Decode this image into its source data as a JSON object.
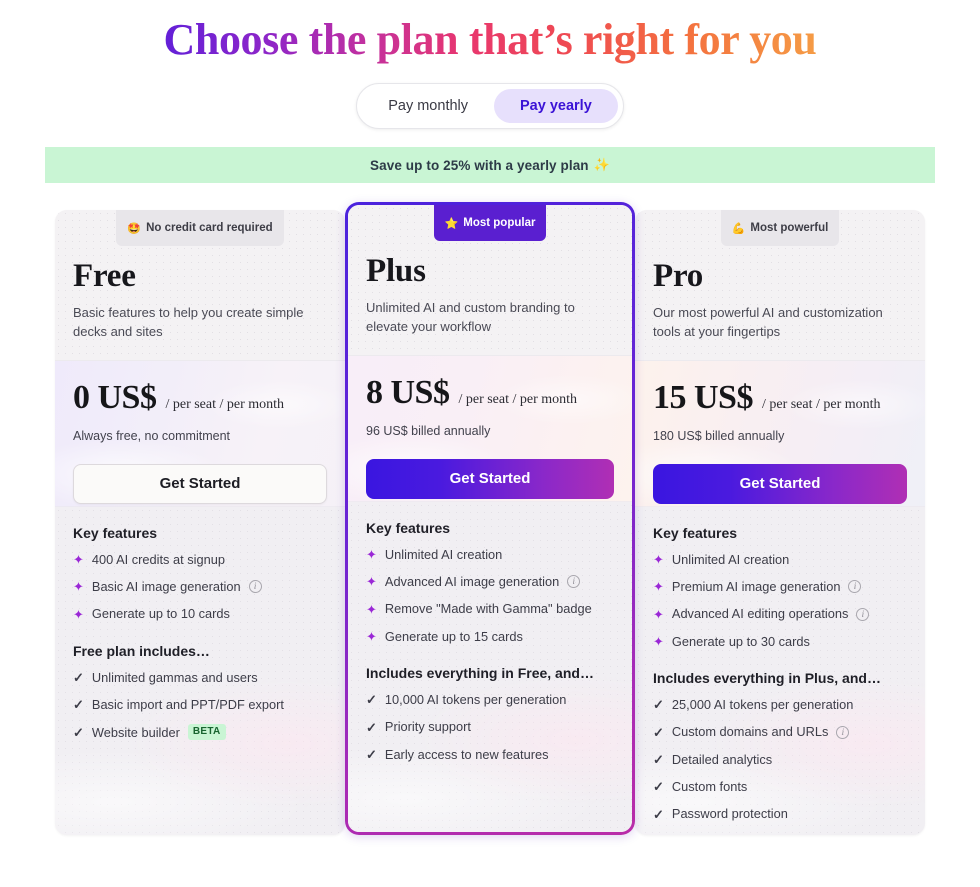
{
  "header": {
    "title": "Choose the plan that’s right for you"
  },
  "billing_toggle": {
    "monthly_label": "Pay monthly",
    "yearly_label": "Pay yearly",
    "selected": "Pay yearly"
  },
  "promo_banner": {
    "text": "Save up to 25% with a yearly plan",
    "emoji": "✨",
    "background": "#c9f5d4",
    "text_color": "#2d3b47"
  },
  "plans": [
    {
      "id": "free",
      "badge": {
        "emoji": "🤩",
        "label": "No credit card required",
        "style": "gray"
      },
      "name": "Free",
      "description": "Basic features to help you create simple decks and sites",
      "price_amount": "0 US$",
      "price_period": "/ per seat / per month",
      "price_note": "Always free, no commitment",
      "cta_label": "Get Started",
      "cta_style": "light",
      "key_features_title": "Key features",
      "key_features": [
        {
          "text": "400 AI credits at signup",
          "info": false
        },
        {
          "text": "Basic AI image generation",
          "info": true
        },
        {
          "text": "Generate up to 10 cards",
          "info": false
        }
      ],
      "includes_title": "Free plan includes…",
      "includes": [
        {
          "text": "Unlimited gammas and users",
          "info": false,
          "badge": ""
        },
        {
          "text": "Basic import and PPT/PDF export",
          "info": false,
          "badge": ""
        },
        {
          "text": "Website builder",
          "info": false,
          "badge": "BETA"
        }
      ]
    },
    {
      "id": "plus",
      "badge": {
        "emoji": "⭐",
        "label": "Most popular",
        "style": "purple"
      },
      "name": "Plus",
      "description": "Unlimited AI and custom branding to elevate your workflow",
      "price_amount": "8 US$",
      "price_period": "/ per seat / per month",
      "price_note": "96 US$ billed annually",
      "cta_label": "Get Started",
      "cta_style": "gradient",
      "key_features_title": "Key features",
      "key_features": [
        {
          "text": "Unlimited AI creation",
          "info": false
        },
        {
          "text": "Advanced AI image generation",
          "info": true
        },
        {
          "text": "Remove \"Made with Gamma\" badge",
          "info": false
        },
        {
          "text": "Generate up to 15 cards",
          "info": false
        }
      ],
      "includes_title": "Includes everything in Free, and…",
      "includes": [
        {
          "text": "10,000 AI tokens per generation",
          "info": false,
          "badge": ""
        },
        {
          "text": "Priority support",
          "info": false,
          "badge": ""
        },
        {
          "text": "Early access to new features",
          "info": false,
          "badge": ""
        }
      ]
    },
    {
      "id": "pro",
      "badge": {
        "emoji": "💪",
        "label": "Most powerful",
        "style": "gray"
      },
      "name": "Pro",
      "description": "Our most powerful AI and customization tools at your fingertips",
      "price_amount": "15 US$",
      "price_period": "/ per seat / per month",
      "price_note": "180 US$ billed annually",
      "cta_label": "Get Started",
      "cta_style": "gradient",
      "key_features_title": "Key features",
      "key_features": [
        {
          "text": "Unlimited AI creation",
          "info": false
        },
        {
          "text": "Premium AI image generation",
          "info": true
        },
        {
          "text": "Advanced AI editing operations",
          "info": true
        },
        {
          "text": "Generate up to 30 cards",
          "info": false
        }
      ],
      "includes_title": "Includes everything in Plus, and…",
      "includes": [
        {
          "text": "25,000 AI tokens per generation",
          "info": false,
          "badge": ""
        },
        {
          "text": "Custom domains and URLs",
          "info": true,
          "badge": ""
        },
        {
          "text": "Detailed analytics",
          "info": false,
          "badge": ""
        },
        {
          "text": "Custom fonts",
          "info": false,
          "badge": ""
        },
        {
          "text": "Password protection",
          "info": false,
          "badge": ""
        }
      ]
    }
  ],
  "icons": {
    "sparkle": "✦",
    "check": "✓",
    "info": "i"
  },
  "colors": {
    "accent_purple": "#5a1fd0",
    "sparkle_purple": "#9a27d6",
    "banner_green": "#c9f5d4",
    "cta_gradient_start": "#3a16e0",
    "cta_gradient_end": "#b02fb4"
  }
}
